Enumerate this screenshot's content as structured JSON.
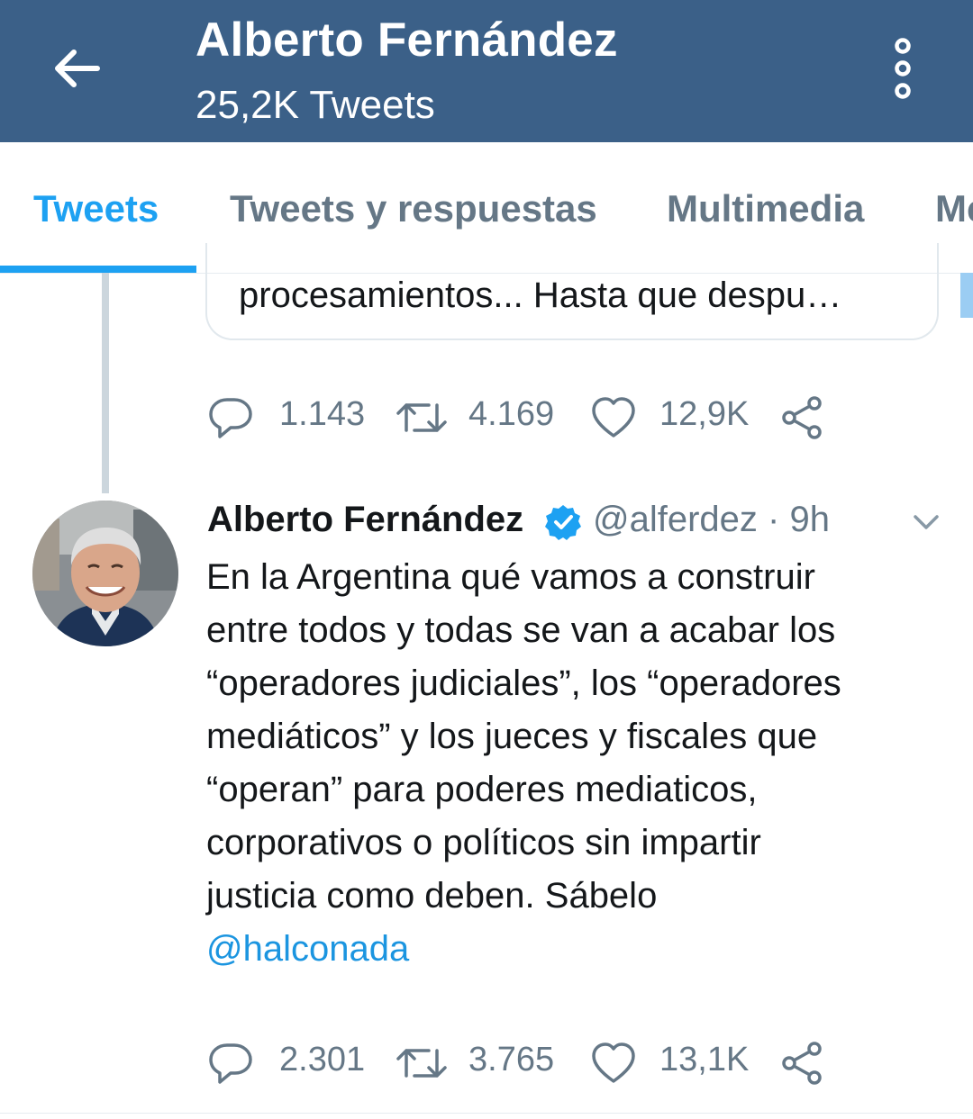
{
  "header": {
    "title": "Alberto Fernández",
    "subtitle": "25,2K Tweets",
    "back_icon": "arrow-left-icon",
    "more_icon": "more-vertical-icon",
    "background": "#3b6088"
  },
  "tabs": [
    {
      "label": "Tweets",
      "active": true
    },
    {
      "label": "Tweets y respuestas",
      "active": false
    },
    {
      "label": "Multimedia",
      "active": false
    },
    {
      "label": "Me",
      "active": false
    }
  ],
  "previous_tweet": {
    "quote_text": "procesamientos... Hasta que despu…",
    "replies": "1.143",
    "retweets": "4.169",
    "likes": "12,9K"
  },
  "tweet": {
    "author_name": "Alberto Fernández",
    "verified": true,
    "handle_time": "@alferdez · 9h",
    "lines": [
      "En la Argentina qué vamos a construir",
      "entre todos y todas se van a acabar los",
      "“operadores judiciales”, los “operadores",
      "mediáticos” y los jueces y fiscales que",
      "“operan” para poderes mediaticos,",
      "corporativos o políticos sin impartir",
      "justicia como deben. Sábelo"
    ],
    "mention": "@halconada",
    "replies": "2.301",
    "retweets": "3.765",
    "likes": "13,1K"
  },
  "colors": {
    "accent": "#1da1f2",
    "muted": "#657786",
    "verified": "#1da1f2"
  }
}
